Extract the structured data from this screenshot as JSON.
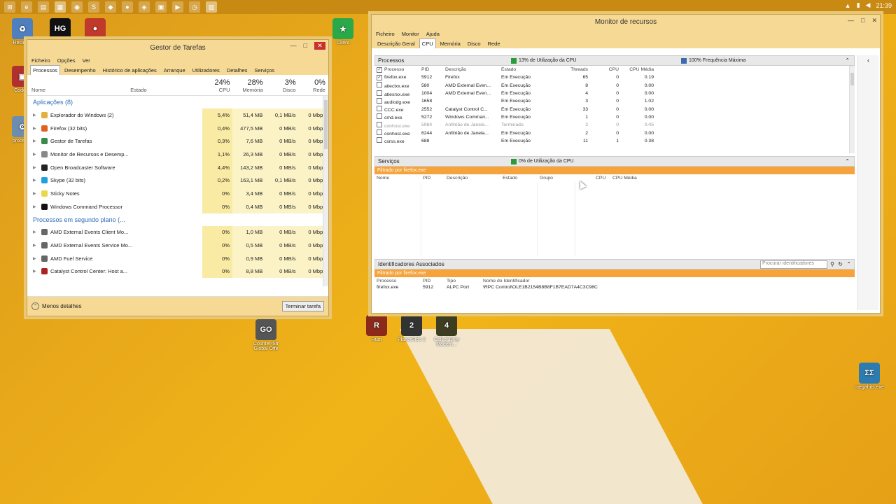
{
  "taskbar": {
    "icons": [
      "start",
      "ie",
      "folder",
      "task-manager",
      "chrome",
      "skype",
      "app1",
      "obs",
      "vs",
      "store",
      "media",
      "clock",
      "resmon"
    ],
    "clock": "21:39"
  },
  "desktop": {
    "icons": [
      {
        "label": "Reciclag",
        "color": "#4f7fbf",
        "glyph": "♻"
      },
      {
        "label": "",
        "color": "#111111",
        "glyph": "HG"
      },
      {
        "label": "",
        "color": "#c0392b",
        "glyph": "●"
      },
      {
        "label": "Codelig",
        "color": "#b03030",
        "glyph": "▣"
      },
      {
        "label": "processo",
        "color": "#6c8cb0",
        "glyph": "⚙"
      },
      {
        "label": "Client",
        "color": "#2aa84a",
        "glyph": "★"
      },
      {
        "label": "Counter-Str Global Offe",
        "color": "#555555",
        "glyph": "GO"
      },
      {
        "label": "Rust",
        "color": "#8b2a1a",
        "glyph": "R"
      },
      {
        "label": "PlanetSide 2",
        "color": "#333333",
        "glyph": "2"
      },
      {
        "label": "Call of Duty Modern...",
        "color": "#3d3d22",
        "glyph": "4"
      },
      {
        "label": "megahits.exe",
        "color": "#2d7cb0",
        "glyph": "ΣΣ"
      }
    ]
  },
  "taskmgr": {
    "title": "Gestor de Tarefas",
    "menu": [
      "Ficheiro",
      "Opções",
      "Ver"
    ],
    "tabs": [
      "Processos",
      "Desempenho",
      "Histórico de aplicações",
      "Arranque",
      "Utilizadores",
      "Detalhes",
      "Serviços"
    ],
    "columns": {
      "name": "Nome",
      "state": "Estado",
      "cpu_pct": "24%",
      "cpu": "CPU",
      "mem_pct": "28%",
      "mem": "Memória",
      "disk_pct": "3%",
      "disk": "Disco",
      "net_pct": "0%",
      "net": "Rede"
    },
    "group_apps": "Aplicações (8)",
    "apps": [
      {
        "name": "Explorador do Windows (2)",
        "cpu": "5,4%",
        "mem": "51,4 MB",
        "disk": "0,1 MB/s",
        "net": "0 Mbps",
        "icon": "#e0b040"
      },
      {
        "name": "Firefox (32 bits)",
        "cpu": "0,4%",
        "mem": "477,5 MB",
        "disk": "0 MB/s",
        "net": "0 Mbps",
        "icon": "#e06020"
      },
      {
        "name": "Gestor de Tarefas",
        "cpu": "0,3%",
        "mem": "7,6 MB",
        "disk": "0 MB/s",
        "net": "0 Mbps",
        "icon": "#3a8a4a"
      },
      {
        "name": "Monitor de Recursos e Desemp...",
        "cpu": "1,1%",
        "mem": "26,3 MB",
        "disk": "0 MB/s",
        "net": "0 Mbps",
        "icon": "#888888"
      },
      {
        "name": "Open Broadcaster Software",
        "cpu": "4,4%",
        "mem": "143,2 MB",
        "disk": "0 MB/s",
        "net": "0 Mbps",
        "icon": "#222222"
      },
      {
        "name": "Skype (32 bits)",
        "cpu": "0,2%",
        "mem": "163,1 MB",
        "disk": "0,1 MB/s",
        "net": "0 Mbps",
        "icon": "#1fa0e0"
      },
      {
        "name": "Sticky Notes",
        "cpu": "0%",
        "mem": "3,4 MB",
        "disk": "0 MB/s",
        "net": "0 Mbps",
        "icon": "#e8d84a"
      },
      {
        "name": "Windows Command Processor",
        "cpu": "0%",
        "mem": "0,4 MB",
        "disk": "0 MB/s",
        "net": "0 Mbps",
        "icon": "#111111"
      }
    ],
    "group_bg": "Processos em segundo plano (...",
    "bg": [
      {
        "name": "AMD External Events Client Mo...",
        "cpu": "0%",
        "mem": "1,0 MB",
        "disk": "0 MB/s",
        "net": "0 Mbps",
        "icon": "#666666"
      },
      {
        "name": "AMD External Events Service Mo...",
        "cpu": "0%",
        "mem": "0,5 MB",
        "disk": "0 MB/s",
        "net": "0 Mbps",
        "icon": "#666666"
      },
      {
        "name": "AMD Fuel Service",
        "cpu": "0%",
        "mem": "0,9 MB",
        "disk": "0 MB/s",
        "net": "0 Mbps",
        "icon": "#666666"
      },
      {
        "name": "Catalyst Control Center: Host a...",
        "cpu": "0%",
        "mem": "8,8 MB",
        "disk": "0 MB/s",
        "net": "0 Mbps",
        "icon": "#aa2222"
      }
    ],
    "fewer_details": "Menos detalhes",
    "end_task": "Terminar tarefa"
  },
  "resmon": {
    "title": "Monitor de recursos",
    "menu": [
      "Ficheiro",
      "Monitor",
      "Ajuda"
    ],
    "tabs": [
      "Descrição Geral",
      "CPU",
      "Memória",
      "Disco",
      "Rede"
    ],
    "processes": {
      "title": "Processos",
      "usage": "13% de Utilização da CPU",
      "freq": "100% Frequência Máxima",
      "columns": [
        "Processo",
        "PID",
        "Descrição",
        "Estado",
        "Threads",
        "CPU",
        "CPU Média"
      ],
      "rows": [
        {
          "name": "firefox.exe",
          "pid": "5912",
          "desc": "Firefox",
          "state": "Em Execução",
          "threads": "65",
          "cpu": "0",
          "avg": "0.19",
          "checked": true
        },
        {
          "name": "atieclxx.exe",
          "pid": "580",
          "desc": "AMD External Even...",
          "state": "Em Execução",
          "threads": "8",
          "cpu": "0",
          "avg": "0.00",
          "checked": false
        },
        {
          "name": "atiesrxx.exe",
          "pid": "1004",
          "desc": "AMD External Even...",
          "state": "Em Execução",
          "threads": "4",
          "cpu": "0",
          "avg": "0.00",
          "checked": false
        },
        {
          "name": "audiodg.exe",
          "pid": "1658",
          "desc": "",
          "state": "Em Execução",
          "threads": "3",
          "cpu": "0",
          "avg": "1.02",
          "checked": false
        },
        {
          "name": "CCC.exe",
          "pid": "2552",
          "desc": "Catalyst Control C...",
          "state": "Em Execução",
          "threads": "33",
          "cpu": "0",
          "avg": "0.00",
          "checked": false
        },
        {
          "name": "cmd.exe",
          "pid": "5272",
          "desc": "Windows Comman...",
          "state": "Em Execução",
          "threads": "1",
          "cpu": "0",
          "avg": "0.00",
          "checked": false
        },
        {
          "name": "conhost.exe",
          "pid": "5984",
          "desc": "Anfitrião de Janela...",
          "state": "Terminado",
          "threads": "2",
          "cpu": "0",
          "avg": "0.05",
          "checked": false
        },
        {
          "name": "conhost.exe",
          "pid": "6244",
          "desc": "Anfitrião de Janela...",
          "state": "Em Execução",
          "threads": "2",
          "cpu": "0",
          "avg": "0.00",
          "checked": false
        },
        {
          "name": "csrss.exe",
          "pid": "688",
          "desc": "",
          "state": "Em Execução",
          "threads": "11",
          "cpu": "1",
          "avg": "0.38",
          "checked": false
        }
      ]
    },
    "services": {
      "title": "Serviços",
      "usage": "0% de Utilização da CPU",
      "filter": "Filtrado por firefox.exe",
      "columns": [
        "Nome",
        "PID",
        "Descrição",
        "Estado",
        "Grupo",
        "CPU",
        "CPU Média"
      ]
    },
    "handles": {
      "title": "Identificadores Associados",
      "search_placeholder": "Procurar identificadores",
      "filter": "Filtrado por firefox.exe",
      "columns": [
        "Processo",
        "PID",
        "Tipo",
        "Nome do Identificador"
      ],
      "row": {
        "proc": "firefox.exe",
        "pid": "5912",
        "type": "ALPC Port",
        "name": "\\RPC Control\\OLE1B2154B8B8F1B7EAD7A4C3C98C"
      }
    }
  }
}
